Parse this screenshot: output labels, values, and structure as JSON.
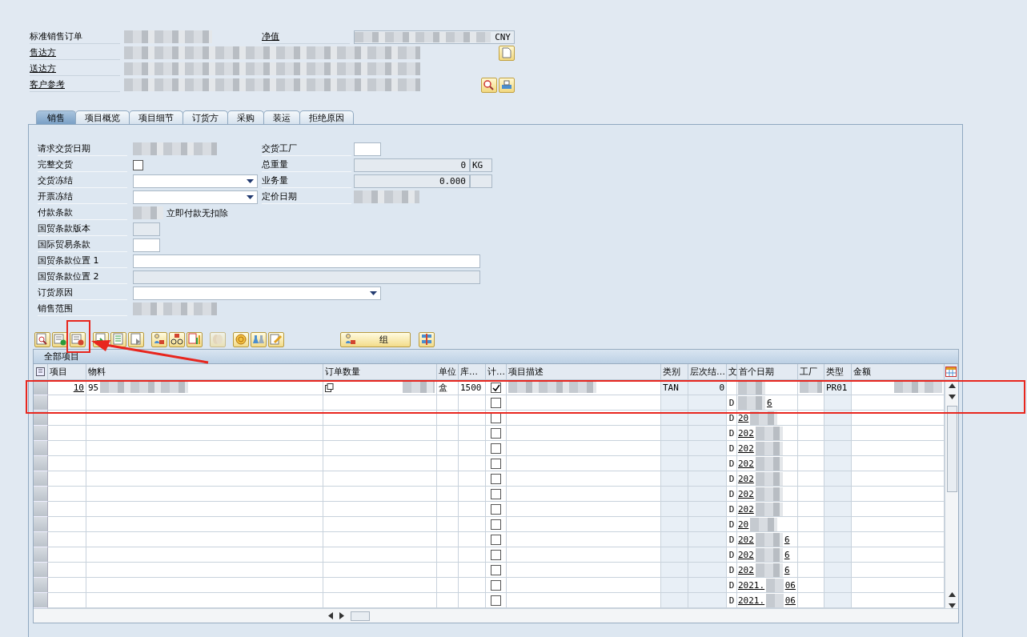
{
  "header": {
    "fields": [
      {
        "label": "标准销售订单",
        "link": false
      },
      {
        "label": "售达方",
        "link": true
      },
      {
        "label": "送达方",
        "link": true
      },
      {
        "label": "客户参考",
        "link": true
      }
    ],
    "net_value": {
      "label": "净值",
      "currency": "CNY"
    }
  },
  "tabs": [
    {
      "label": "销售",
      "selected": true
    },
    {
      "label": "项目概览",
      "selected": false
    },
    {
      "label": "项目细节",
      "selected": false
    },
    {
      "label": "订货方",
      "selected": false
    },
    {
      "label": "采购",
      "selected": false
    },
    {
      "label": "装运",
      "selected": false
    },
    {
      "label": "拒绝原因",
      "selected": false
    }
  ],
  "form": {
    "left": [
      {
        "label": "请求交货日期",
        "kind": "redacted"
      },
      {
        "label": "完整交货",
        "kind": "checkbox",
        "checked": false
      },
      {
        "label": "交货冻结",
        "kind": "dropdown"
      },
      {
        "label": "开票冻结",
        "kind": "dropdown"
      },
      {
        "label": "付款条款",
        "kind": "redacted",
        "text": "立即付款无扣除"
      },
      {
        "label": "国贸条款版本",
        "kind": "small",
        "disabled": true
      },
      {
        "label": "国际贸易条款",
        "kind": "small",
        "disabled": false
      },
      {
        "label": "国贸条款位置 1",
        "kind": "wide",
        "disabled": false
      },
      {
        "label": "国贸条款位置 2",
        "kind": "wide",
        "disabled": true
      },
      {
        "label": "订货原因",
        "kind": "dropdown-wide"
      },
      {
        "label": "销售范围",
        "kind": "redacted"
      }
    ],
    "right": [
      {
        "label": "交货工厂",
        "kind": "small",
        "disabled": false
      },
      {
        "label": "总重量",
        "kind": "quantity",
        "value": "0",
        "unit": "KG"
      },
      {
        "label": "业务量",
        "kind": "quantity",
        "value": "0.000"
      },
      {
        "label": "定价日期",
        "kind": "redacted"
      }
    ]
  },
  "toolbar": {
    "group_button": "组"
  },
  "table": {
    "title": "全部项目",
    "columns": [
      "项目",
      "物料",
      "订单数量",
      "单位",
      "库…",
      "计…",
      "项目描述",
      "类别",
      "层次结…",
      "文",
      "首个日期",
      "工厂",
      "类型",
      "金额"
    ],
    "rows": [
      {
        "item": "10",
        "material": "95",
        "unit": "盒",
        "stock": "1500",
        "checked": true,
        "category": "TAN",
        "level": "0",
        "type": "PR01"
      },
      {
        "checked": false,
        "doc": "D",
        "date_end": "6"
      },
      {
        "checked": false,
        "doc": "D",
        "date_start": "20"
      },
      {
        "checked": false,
        "doc": "D",
        "date_start": "202"
      },
      {
        "checked": false,
        "doc": "D",
        "date_start": "202"
      },
      {
        "checked": false,
        "doc": "D",
        "date_start": "202"
      },
      {
        "checked": false,
        "doc": "D",
        "date_start": "202"
      },
      {
        "checked": false,
        "doc": "D",
        "date_start": "202"
      },
      {
        "checked": false,
        "doc": "D",
        "date_start": "202"
      },
      {
        "checked": false,
        "doc": "D",
        "date_start": "20"
      },
      {
        "checked": false,
        "doc": "D",
        "date_start": "202",
        "date_end": "6"
      },
      {
        "checked": false,
        "doc": "D",
        "date_start": "202",
        "date_end": "6"
      },
      {
        "checked": false,
        "doc": "D",
        "date_start": "202",
        "date_end": "6"
      },
      {
        "checked": false,
        "doc": "D",
        "date_start": "2021.",
        "date_end": "06"
      },
      {
        "checked": false,
        "doc": "D",
        "date_start": "2021.",
        "date_end": "06"
      }
    ]
  },
  "annotations": [
    {
      "kind": "box"
    },
    {
      "kind": "arrow"
    },
    {
      "kind": "wide-box"
    }
  ]
}
